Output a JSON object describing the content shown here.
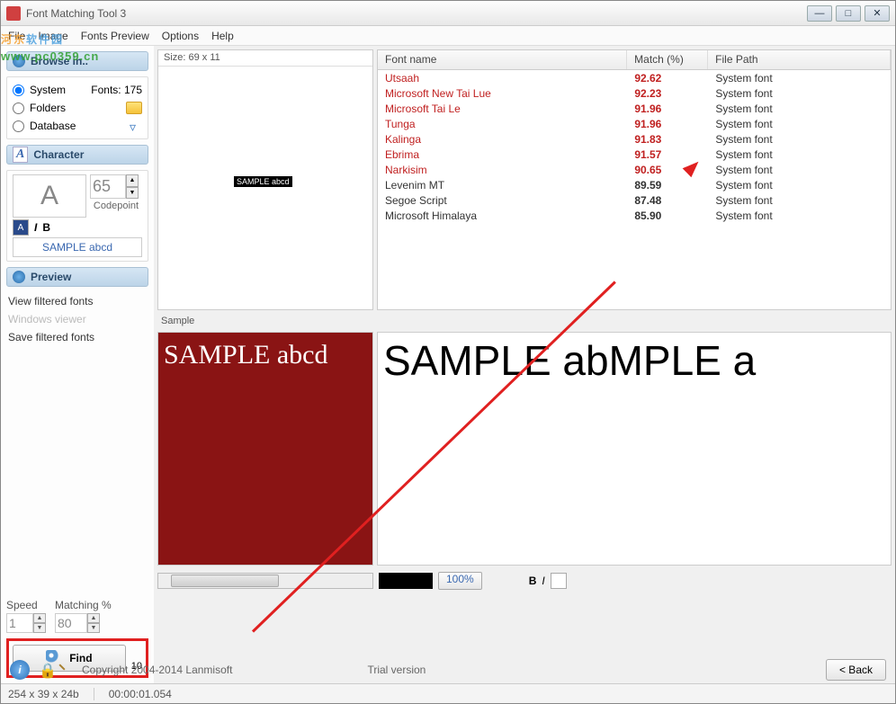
{
  "title": "Font Matching Tool 3",
  "menu": [
    "File",
    "Image",
    "Fonts Preview",
    "Options",
    "Help"
  ],
  "browse": {
    "header": "Browse in..",
    "system": "System",
    "fonts_count": "Fonts: 175",
    "folders": "Folders",
    "database": "Database"
  },
  "character": {
    "header": "Character",
    "glyph": "A",
    "code": "65",
    "codepoint_label": "Codepoint",
    "sample_input": "SAMPLE abcd"
  },
  "preview": {
    "header": "Preview",
    "items": [
      {
        "label": "View filtered fonts",
        "disabled": false
      },
      {
        "label": "Windows viewer",
        "disabled": true
      },
      {
        "label": "Save filtered fonts",
        "disabled": false
      }
    ]
  },
  "speed": {
    "label": "Speed",
    "value": "1"
  },
  "matching": {
    "label": "Matching %",
    "value": "80"
  },
  "find": {
    "label": "Find",
    "count": "10"
  },
  "size_info": "Size: 69 x 11",
  "sample_chip": "SAMPLE abcd",
  "table": {
    "headers": [
      "Font name",
      "Match (%)",
      "File Path"
    ],
    "rows": [
      {
        "name": "Utsaah",
        "match": "92.62",
        "path": "System font",
        "hot": true
      },
      {
        "name": "Microsoft New Tai Lue",
        "match": "92.23",
        "path": "System font",
        "hot": true
      },
      {
        "name": "Microsoft Tai Le",
        "match": "91.96",
        "path": "System font",
        "hot": true
      },
      {
        "name": "Tunga",
        "match": "91.96",
        "path": "System font",
        "hot": true
      },
      {
        "name": "Kalinga",
        "match": "91.83",
        "path": "System font",
        "hot": true
      },
      {
        "name": "Ebrima",
        "match": "91.57",
        "path": "System font",
        "hot": true
      },
      {
        "name": "Narkisim",
        "match": "90.65",
        "path": "System font",
        "hot": true
      },
      {
        "name": "Levenim MT",
        "match": "89.59",
        "path": "System font",
        "hot": false
      },
      {
        "name": "Segoe Script",
        "match": "87.48",
        "path": "System font",
        "hot": false
      },
      {
        "name": "Microsoft Himalaya",
        "match": "85.90",
        "path": "System font",
        "hot": false
      }
    ]
  },
  "sample_label": "Sample",
  "red_sample": "SAMPLE abcd",
  "big_sample": "SAMPLE abMPLE a",
  "zoom": "100%",
  "bold": "B",
  "italic": "I",
  "footer": {
    "copyright": "Copyright 2004-2014 Lanmisoft",
    "trial": "Trial version",
    "back": "< Back"
  },
  "status": {
    "dims": "254 x 39 x 24b",
    "time": "00:00:01.054"
  },
  "watermark": {
    "cn1": "河东",
    "cn2": "软件园",
    "url": "www.pc0359.cn"
  }
}
